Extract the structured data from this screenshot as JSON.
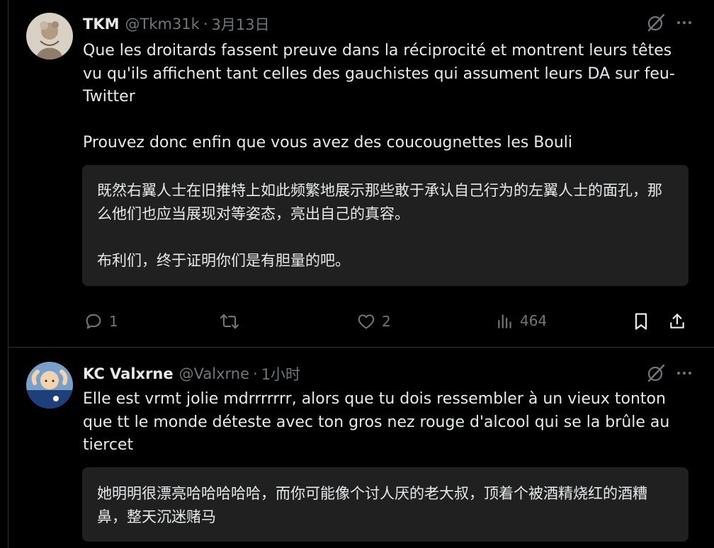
{
  "colors": {
    "background": "#000000",
    "text": "#e7e9ea",
    "secondary": "#71767b",
    "translation_bg": "#202020",
    "divider": "#2f3336"
  },
  "tweets": [
    {
      "name": "TKM",
      "handle": "@Tkm31k",
      "separator": "·",
      "time": "3月13日",
      "text": "Que les droitards fassent preuve dans la réciprocité et montrent leurs têtes vu qu'ils affichent tant celles des gauchistes qui assument leurs DA sur feu-Twitter\n\nProuvez donc enfin que vous avez des coucougnettes les Bouli",
      "translation": "既然右翼人士在旧推特上如此频繁地展示那些敢于承认自己行为的左翼人士的面孔，那么他们也应当展现对等姿态，亮出自己的真容。\n\n布利们，终于证明你们是有胆量的吧。",
      "replies": "1",
      "retweets": "",
      "likes": "2",
      "views": "464",
      "icons": [
        "avatar",
        "grok-icon",
        "more-icon",
        "reply-icon",
        "retweet-icon",
        "like-icon",
        "views-icon",
        "bookmark-icon",
        "share-icon"
      ]
    },
    {
      "name": "KC Valxrne",
      "handle": "@Valxrne",
      "separator": "·",
      "time": "1小时",
      "text": "Elle est vrmt jolie mdrrrrrrr, alors que tu dois ressembler à un vieux tonton que tt le monde déteste avec ton gros nez rouge d'alcool qui se la brûle au tiercet",
      "translation": "她明明很漂亮哈哈哈哈哈，而你可能像个讨人厌的老大叔，顶着个被酒精烧红的酒糟鼻，整天沉迷赌马",
      "icons": [
        "avatar",
        "grok-icon",
        "more-icon"
      ]
    }
  ]
}
